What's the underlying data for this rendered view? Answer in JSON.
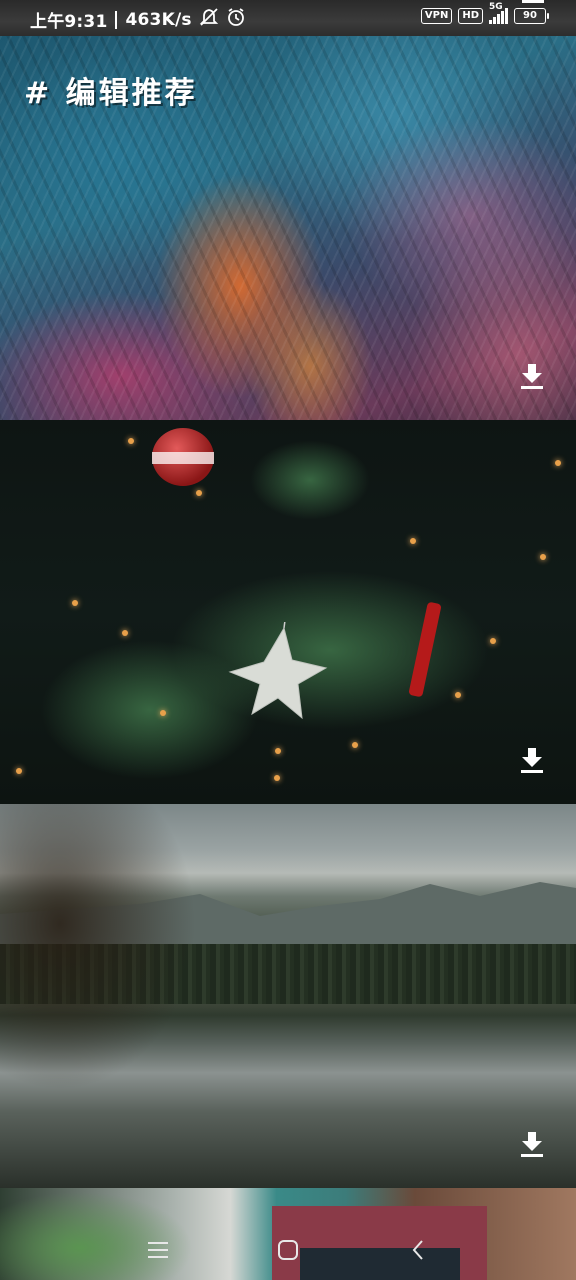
{
  "status_bar": {
    "time": "上午9:31",
    "net_speed": "463K/s",
    "vpn_label": "VPN",
    "hd_label": "HD",
    "signal_label": "5G",
    "battery_level": "90"
  },
  "feed": {
    "section_title": "# 编辑推荐",
    "cards": [
      {
        "name": "abstract-light-painting"
      },
      {
        "name": "christmas-star-ornament"
      },
      {
        "name": "mountain-lake-reflection"
      },
      {
        "name": "plant-interior"
      }
    ]
  },
  "icons": {
    "download": "download-icon",
    "menu": "menu-icon",
    "home": "home-icon",
    "back": "back-icon"
  }
}
